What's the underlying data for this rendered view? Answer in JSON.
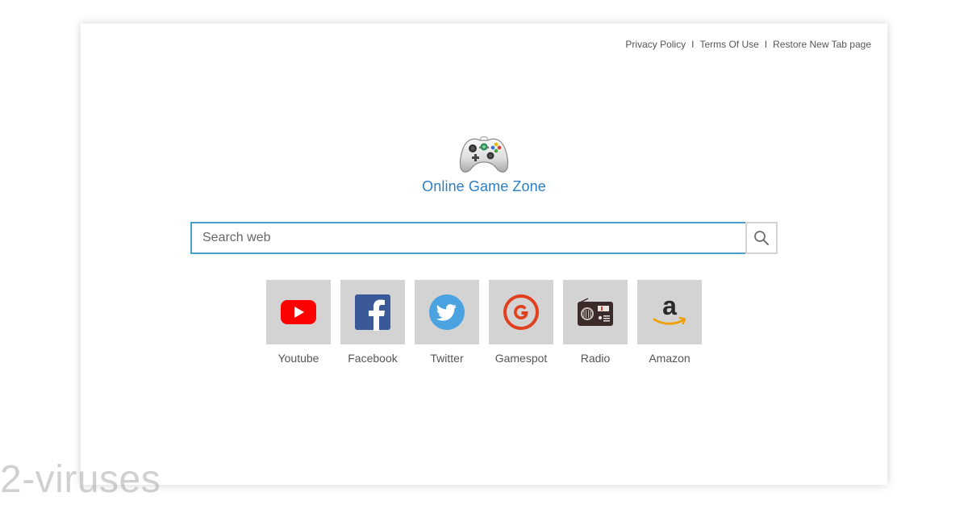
{
  "header": {
    "links": [
      {
        "label": "Privacy Policy"
      },
      {
        "label": "Terms Of Use"
      },
      {
        "label": "Restore New Tab page"
      }
    ],
    "separator": "I"
  },
  "logo": {
    "icon": "gamepad-icon",
    "title": "Online Game Zone",
    "title_color": "#2d7fc0"
  },
  "search": {
    "placeholder": "Search web",
    "button_icon": "search-icon",
    "border_color": "#4b9ed0"
  },
  "tiles": [
    {
      "label": "Youtube",
      "icon": "youtube-icon"
    },
    {
      "label": "Facebook",
      "icon": "facebook-icon"
    },
    {
      "label": "Twitter",
      "icon": "twitter-icon"
    },
    {
      "label": "Gamespot",
      "icon": "gamespot-icon"
    },
    {
      "label": "Radio",
      "icon": "radio-icon"
    },
    {
      "label": "Amazon",
      "icon": "amazon-icon"
    }
  ],
  "watermark": {
    "text": "2-viruses"
  }
}
